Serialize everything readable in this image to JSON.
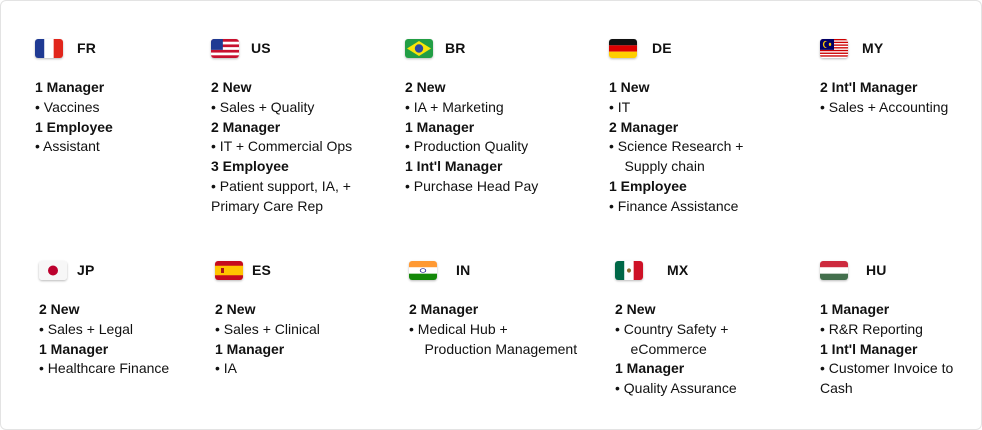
{
  "countries": [
    {
      "code": "FR",
      "flag": "flag-france-icon",
      "groups": [
        {
          "title": "1 Manager",
          "items": [
            "• Vaccines"
          ]
        },
        {
          "title": "1 Employee",
          "items": [
            "• Assistant"
          ]
        }
      ]
    },
    {
      "code": "US",
      "flag": "flag-usa-icon",
      "groups": [
        {
          "title": "2 New",
          "items": [
            "•  Sales + Quality"
          ]
        },
        {
          "title": "2 Manager",
          "items": [
            "•  IT + Commercial Ops"
          ]
        },
        {
          "title": "3 Employee",
          "items": [
            "• Patient support, IA, +",
            "Primary Care Rep"
          ]
        }
      ]
    },
    {
      "code": "BR",
      "flag": "flag-brazil-icon",
      "groups": [
        {
          "title": "2 New",
          "items": [
            "•  IA + Marketing"
          ]
        },
        {
          "title": "1 Manager",
          "items": [
            "•  Production Quality"
          ]
        },
        {
          "title": "1 Int'l Manager",
          "items": [
            "• Purchase Head Pay"
          ]
        }
      ]
    },
    {
      "code": "DE",
      "flag": "flag-germany-icon",
      "groups": [
        {
          "title": "1 New",
          "items": [
            "•  IT"
          ]
        },
        {
          "title": "2 Manager",
          "items": [
            "•  Science Research +",
            "    Supply chain"
          ]
        },
        {
          "title": "1 Employee",
          "items": [
            "• Finance Assistance"
          ]
        }
      ]
    },
    {
      "code": "MY",
      "flag": "flag-malaysia-icon",
      "groups": [
        {
          "title": "2 Int'l Manager",
          "items": [
            "• Sales + Accounting"
          ]
        }
      ]
    },
    {
      "code": "JP",
      "flag": "flag-japan-icon",
      "groups": [
        {
          "title": "2 New",
          "items": [
            "•  Sales + Legal"
          ]
        },
        {
          "title": "1 Manager",
          "items": [
            "•  Healthcare Finance"
          ]
        }
      ]
    },
    {
      "code": "ES",
      "flag": "flag-spain-icon",
      "groups": [
        {
          "title": "2 New",
          "items": [
            "•  Sales + Clinical"
          ]
        },
        {
          "title": "1 Manager",
          "items": [
            "•  IA"
          ]
        }
      ]
    },
    {
      "code": "IN",
      "flag": "flag-india-icon",
      "groups": [
        {
          "title": "2 Manager",
          "items": [
            "•  Medical Hub +",
            "    Production Management"
          ]
        }
      ]
    },
    {
      "code": "MX",
      "flag": "flag-mexico-icon",
      "groups": [
        {
          "title": "2 New",
          "items": [
            "•  Country Safety +",
            "    eCommerce"
          ]
        },
        {
          "title": "1 Manager",
          "items": [
            "•  Quality Assurance"
          ]
        }
      ]
    },
    {
      "code": "HU",
      "flag": "flag-hungary-icon",
      "groups": [
        {
          "title": "1 Manager",
          "items": [
            "•  R&R Reporting"
          ]
        },
        {
          "title": "1 Int'l Manager",
          "items": [
            "• Customer Invoice to",
            "Cash"
          ]
        }
      ]
    }
  ]
}
